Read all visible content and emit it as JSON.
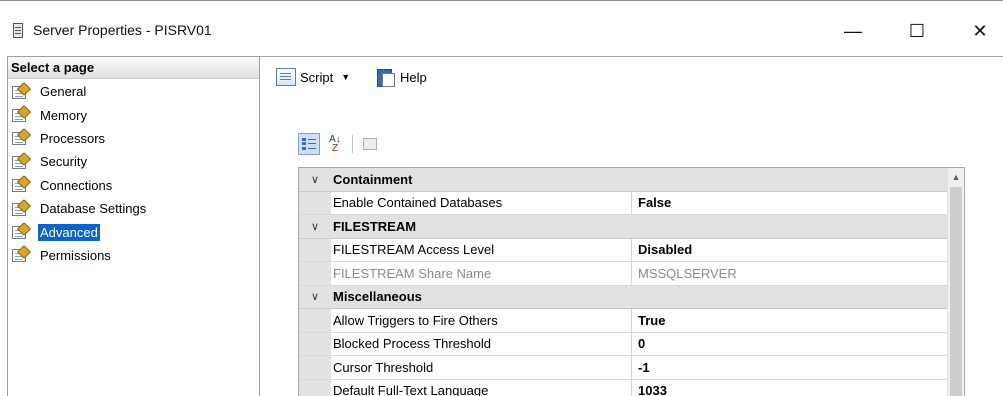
{
  "window": {
    "title": "Server Properties - PISRV01",
    "minimize_glyph": "—",
    "maximize_glyph": "☐",
    "close_glyph": "✕"
  },
  "left": {
    "header": "Select a page",
    "pages": [
      {
        "label": "General",
        "icon": "page-wrench-icon"
      },
      {
        "label": "Memory",
        "icon": "page-wrench-icon"
      },
      {
        "label": "Processors",
        "icon": "page-wrench-icon"
      },
      {
        "label": "Security",
        "icon": "page-wrench-icon"
      },
      {
        "label": "Connections",
        "icon": "page-wrench-icon"
      },
      {
        "label": "Database Settings",
        "icon": "page-wrench-icon"
      },
      {
        "label": "Advanced",
        "icon": "page-wrench-icon",
        "selected": true
      },
      {
        "label": "Permissions",
        "icon": "page-wrench-icon"
      }
    ]
  },
  "toolbar": {
    "script_label": "Script",
    "dropdown_arrow": "▼",
    "help_label": "Help"
  },
  "grid_toolbar": {
    "sort_alpha_glyph": "A↓",
    "sort_alpha_sub": "Z"
  },
  "grid": {
    "expand_glyph": "∨",
    "scroll_up_glyph": "▲",
    "categories": [
      {
        "name": "Containment",
        "properties": [
          {
            "name": "Enable Contained Databases",
            "value": "False"
          }
        ]
      },
      {
        "name": "FILESTREAM",
        "properties": [
          {
            "name": "FILESTREAM Access Level",
            "value": "Disabled"
          },
          {
            "name": "FILESTREAM Share Name",
            "value": "MSSQLSERVER",
            "readonly": true
          }
        ]
      },
      {
        "name": "Miscellaneous",
        "properties": [
          {
            "name": "Allow Triggers to Fire Others",
            "value": "True"
          },
          {
            "name": "Blocked Process Threshold",
            "value": "0"
          },
          {
            "name": "Cursor Threshold",
            "value": "-1"
          },
          {
            "name": "Default Full-Text Language",
            "value": "1033"
          }
        ]
      }
    ]
  },
  "colors": {
    "selection": "#0a64c9",
    "category_bg": "#e2e2e2",
    "readonly_text": "#8c8c8c"
  }
}
